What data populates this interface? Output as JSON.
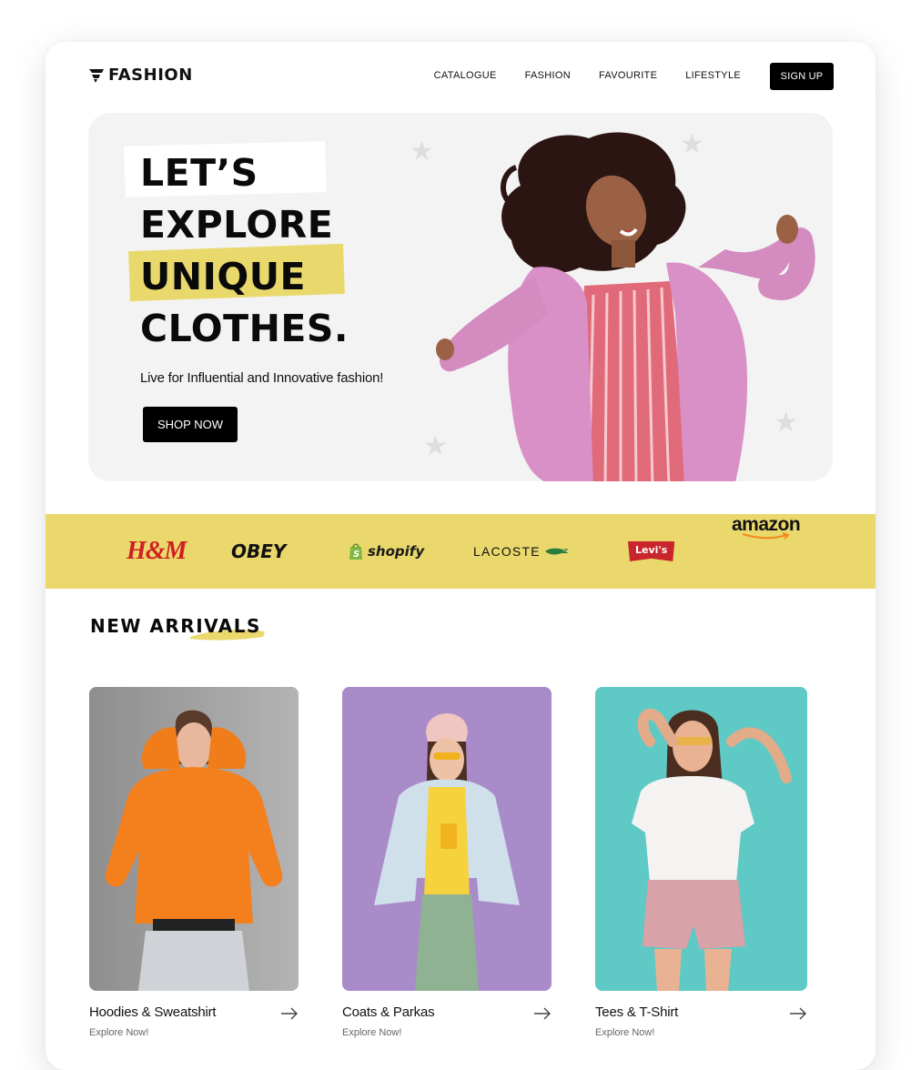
{
  "brand": {
    "name": "FASHION"
  },
  "nav": {
    "items": [
      {
        "label": "CATALOGUE"
      },
      {
        "label": "FASHION"
      },
      {
        "label": "FAVOURITE"
      },
      {
        "label": "LIFESTYLE"
      }
    ],
    "signup_label": "SIGN UP"
  },
  "hero": {
    "headline": [
      "LET’S",
      "EXPLORE",
      "UNIQUE",
      "CLOTHES."
    ],
    "tagline": "Live for Influential and Innovative fashion!",
    "cta_label": "SHOP NOW"
  },
  "partners": {
    "brands": [
      "H&M",
      "OBEY",
      "shopify",
      "LACOSTE",
      "Levi's",
      "amazon"
    ]
  },
  "arrivals": {
    "title": "NEW ARRIVALS",
    "cards": [
      {
        "title": "Hoodies & Sweatshirt",
        "subtitle": "Explore Now!"
      },
      {
        "title": "Coats & Parkas",
        "subtitle": "Explore Now!"
      },
      {
        "title": "Tees & T-Shirt",
        "subtitle": "Explore Now!"
      }
    ]
  },
  "colors": {
    "accent_yellow": "#ead86c",
    "dark": "#000000",
    "hero_bg": "#f2f3f2",
    "card_grey": "#9c9c9c",
    "card_purple": "#a98bc9",
    "card_teal": "#5fc9c6"
  }
}
